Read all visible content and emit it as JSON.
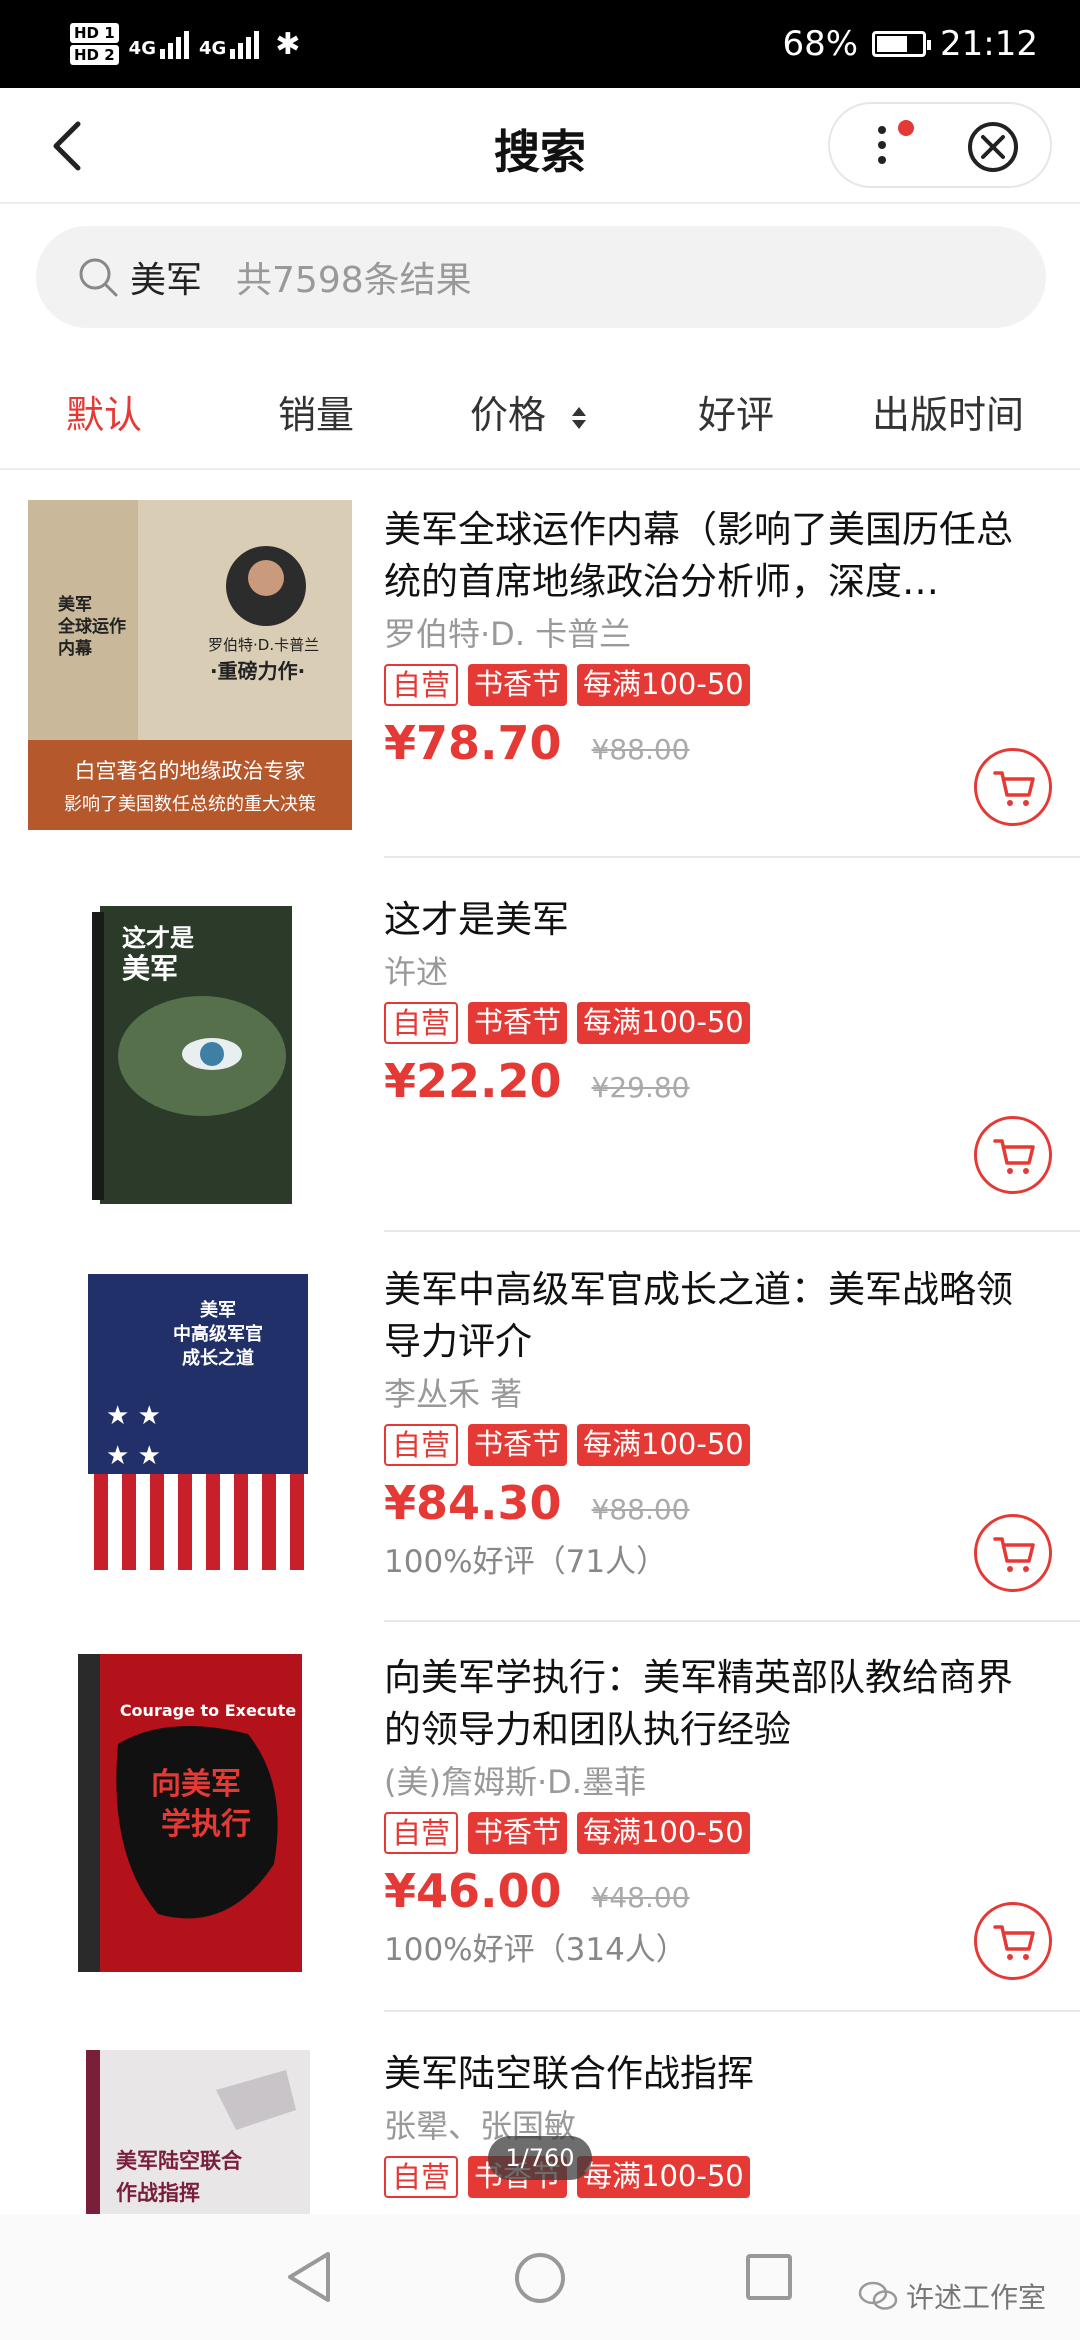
{
  "status_bar": {
    "hd1": "HD 1",
    "hd2": "HD 2",
    "net1": "4G",
    "net2": "4G",
    "battery": "68%",
    "time": "21:12"
  },
  "nav": {
    "title": "搜索"
  },
  "search": {
    "keyword": "美军",
    "result_count": "共7598条结果"
  },
  "sort_tabs": [
    "默认",
    "销量",
    "价格",
    "好评",
    "出版时间"
  ],
  "products": [
    {
      "name": "美军全球运作内幕（影响了美国历任总统的首席地缘政治分析师，深度…",
      "author": "罗伯特·D. 卡普兰",
      "tags": [
        "自营",
        "书香节",
        "每满100-50"
      ],
      "price": "¥78.70",
      "original_price": "¥88.00",
      "rating": "",
      "cover_text": [
        "美军",
        "全球运作",
        "内幕",
        "罗伯特·D.卡普兰",
        "·重磅力作·",
        "白宫著名的地缘政治专家",
        "影响了美国数任总统的重大决策"
      ]
    },
    {
      "name": "这才是美军",
      "author": "许述",
      "tags": [
        "自营",
        "书香节",
        "每满100-50"
      ],
      "price": "¥22.20",
      "original_price": "¥29.80",
      "rating": "",
      "cover_text": [
        "这才是",
        "美军"
      ]
    },
    {
      "name": "美军中高级军官成长之道：美军战略领导力评介",
      "author": "李丛禾 著",
      "tags": [
        "自营",
        "书香节",
        "每满100-50"
      ],
      "price": "¥84.30",
      "original_price": "¥88.00",
      "rating": "100%好评（71人）",
      "cover_text": [
        "美军",
        "中高级军官",
        "成长之道"
      ]
    },
    {
      "name": "向美军学执行：美军精英部队教给商界的领导力和团队执行经验",
      "author": "(美)詹姆斯·D.墨菲",
      "tags": [
        "自营",
        "书香节",
        "每满100-50"
      ],
      "price": "¥46.00",
      "original_price": "¥48.00",
      "rating": "100%好评（314人）",
      "cover_text": [
        "Courage to Execute",
        "向美军",
        "学执行"
      ]
    },
    {
      "name": "美军陆空联合作战指挥",
      "author": "张翚、张国敏",
      "tags": [
        "自营",
        "书香节",
        "每满100-50"
      ],
      "price": "",
      "original_price": "",
      "rating": "",
      "cover_text": [
        "美军陆空联合",
        "作战指挥"
      ]
    }
  ],
  "page_indicator": "1/760",
  "watermark": "许述工作室",
  "colors": {
    "accent": "#e53935"
  }
}
